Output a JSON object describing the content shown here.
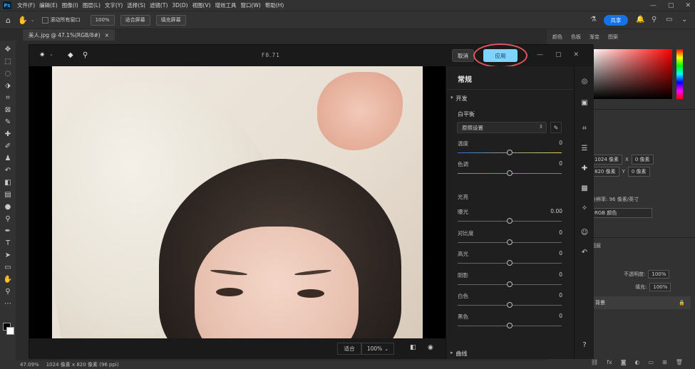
{
  "menubar": {
    "items": [
      "文件(F)",
      "编辑(E)",
      "图像(I)",
      "图层(L)",
      "文字(Y)",
      "选择(S)",
      "滤镜(T)",
      "3D(D)",
      "视图(V)",
      "增效工具",
      "窗口(W)",
      "帮助(H)"
    ],
    "logo": "Ps"
  },
  "optionsbar": {
    "scroll_all": "滚动所有窗口",
    "zoom": "100%",
    "fit_screen": "适合屏幕",
    "fill_screen": "填充屏幕",
    "share": "共享"
  },
  "document": {
    "tab": "美人.jpg @ 47.1%(RGB/8#)",
    "close": "×"
  },
  "statusbar": {
    "zoom": "47.09%",
    "size": "1024 像素 x 820 像素 (96 ppi)"
  },
  "right_panel": {
    "tabs": [
      "颜色",
      "色板",
      "渐变",
      "图案"
    ],
    "width_label": "1024 像素",
    "x_label": "X",
    "x_value": "0 像素",
    "height_label": "820 像素",
    "y_label": "Y",
    "y_value": "0 像素",
    "resolution": "分辨率: 96 像素/英寸",
    "mode": "RGB 颜色",
    "layers_tab": "图层",
    "opacity_label": "不透明度:",
    "opacity_value": "100%",
    "fill_label": "填充:",
    "fill_value": "100%",
    "layer_name": "背景",
    "lock_icon": "🔒"
  },
  "camera_raw": {
    "title": "F8.71",
    "cancel": "取消",
    "apply": "应用",
    "panel_title": "常规",
    "section_basic": "开发",
    "white_balance_label": "白平衡",
    "white_balance_value": "原照设置",
    "temperature_label": "温度",
    "temperature_value": "0",
    "tint_label": "色调",
    "tint_value": "0",
    "light_label": "光亮",
    "exposure_label": "曝光",
    "exposure_value": "0.00",
    "contrast_label": "对比度",
    "contrast_value": "0",
    "highlights_label": "高光",
    "highlights_value": "0",
    "shadows_label": "阴影",
    "shadows_value": "0",
    "whites_label": "白色",
    "whites_value": "0",
    "blacks_label": "黑色",
    "blacks_value": "0",
    "section_curve": "曲线",
    "fit_label": "适合",
    "zoom_label": "100%"
  },
  "colors": {
    "apply_button": "#7fd4ff",
    "annotation": "#e0565b",
    "accent": "#1473e6"
  }
}
